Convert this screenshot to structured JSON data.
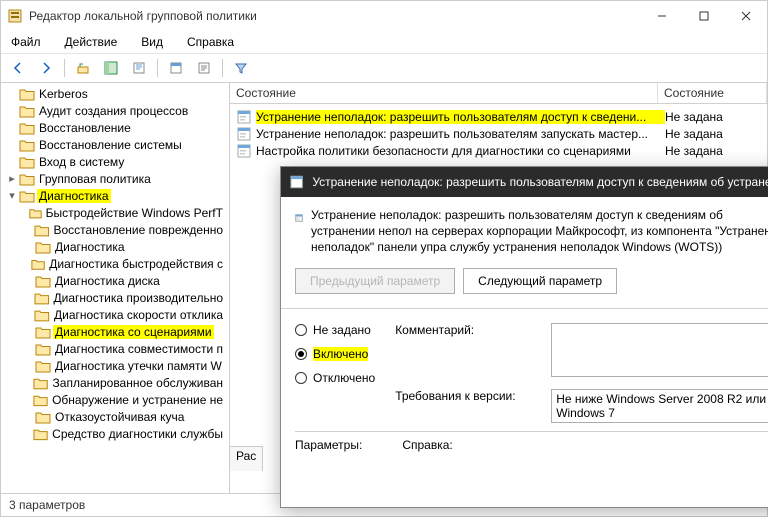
{
  "window": {
    "title": "Редактор локальной групповой политики"
  },
  "menu": {
    "file": "Файл",
    "action": "Действие",
    "view": "Вид",
    "help": "Справка"
  },
  "tree": [
    {
      "d": 1,
      "label": "Kerberos",
      "tw": ""
    },
    {
      "d": 1,
      "label": "Аудит создания процессов",
      "tw": ""
    },
    {
      "d": 1,
      "label": "Восстановление",
      "tw": ""
    },
    {
      "d": 1,
      "label": "Восстановление системы",
      "tw": ""
    },
    {
      "d": 1,
      "label": "Вход в систему",
      "tw": ""
    },
    {
      "d": 1,
      "label": "Групповая политика",
      "tw": "▸"
    },
    {
      "d": 1,
      "label": "Диагностика",
      "tw": "▾",
      "hl": true
    },
    {
      "d": 2,
      "label": "Быстродействие Windows PerfT",
      "tw": ""
    },
    {
      "d": 2,
      "label": "Восстановление поврежденно",
      "tw": ""
    },
    {
      "d": 2,
      "label": "Диагностика",
      "tw": ""
    },
    {
      "d": 2,
      "label": "Диагностика быстродействия с",
      "tw": ""
    },
    {
      "d": 2,
      "label": "Диагностика диска",
      "tw": ""
    },
    {
      "d": 2,
      "label": "Диагностика производительно",
      "tw": ""
    },
    {
      "d": 2,
      "label": "Диагностика скорости отклика",
      "tw": ""
    },
    {
      "d": 2,
      "label": "Диагностика со сценариями",
      "tw": "",
      "hl": true
    },
    {
      "d": 2,
      "label": "Диагностика совместимости п",
      "tw": ""
    },
    {
      "d": 2,
      "label": "Диагностика утечки памяти W",
      "tw": ""
    },
    {
      "d": 2,
      "label": "Запланированное обслуживан",
      "tw": ""
    },
    {
      "d": 2,
      "label": "Обнаружение и устранение не",
      "tw": ""
    },
    {
      "d": 2,
      "label": "Отказоустойчивая куча",
      "tw": ""
    },
    {
      "d": 2,
      "label": "Средство диагностики службы",
      "tw": ""
    }
  ],
  "list": {
    "header_main": "Состояние",
    "header_state": "Состояние",
    "rows": [
      {
        "name": "Устранение неполадок: разрешить пользователям доступ к сведени...",
        "state": "Не задана",
        "hl": true
      },
      {
        "name": "Устранение неполадок: разрешить пользователям запускать мастер...",
        "state": "Не задана"
      },
      {
        "name": "Настройка политики безопасности для диагностики со сценариями",
        "state": "Не задана"
      }
    ]
  },
  "dialog": {
    "title": "Устранение неполадок: разрешить пользователям доступ к сведениям об устранении неп",
    "desc": "Устранение неполадок: разрешить пользователям доступ к сведениям об устранении непол на серверах корпорации Майкрософт, из компонента \"Устранение неполадок\" панели упра службу устранения неполадок Windows (WOTS))",
    "prev": "Предыдущий параметр",
    "next": "Следующий параметр",
    "opt_na": "Не задано",
    "opt_on": "Включено",
    "opt_off": "Отключено",
    "comment_label": "Комментарий:",
    "req_label": "Требования к версии:",
    "req_value": "Не ниже Windows Server 2008 R2 или Windows 7",
    "params": "Параметры:",
    "help": "Справка:"
  },
  "tab": "Рас",
  "status": "3 параметров"
}
